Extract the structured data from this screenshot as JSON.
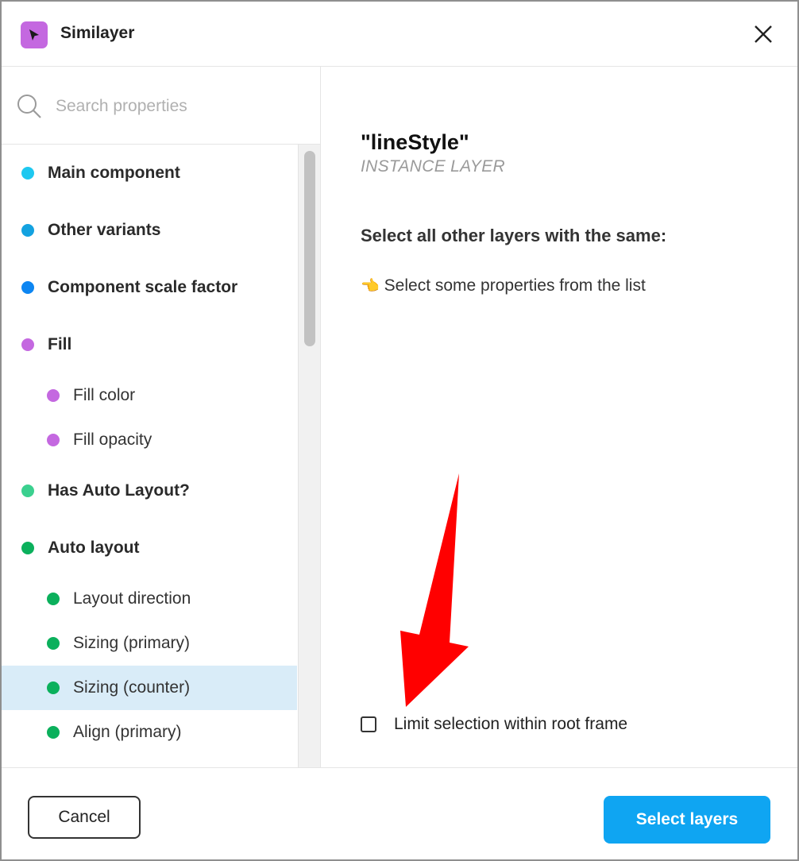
{
  "window": {
    "title": "Similayer",
    "app_icon": "cursor-arrow-icon",
    "app_icon_color": "#c468e0",
    "close_icon": "close-icon"
  },
  "search": {
    "placeholder": "Search properties",
    "value": ""
  },
  "properties": [
    {
      "label": "Main component",
      "color": "#1ec8f0",
      "level": "top",
      "selected": false
    },
    {
      "label": "Other variants",
      "color": "#13a2e0",
      "level": "top",
      "selected": false
    },
    {
      "label": "Component scale factor",
      "color": "#0d86f2",
      "level": "top",
      "selected": false
    },
    {
      "label": "Fill",
      "color": "#c468e0",
      "level": "top",
      "selected": false
    },
    {
      "label": "Fill color",
      "color": "#c468e0",
      "level": "sub",
      "selected": false
    },
    {
      "label": "Fill opacity",
      "color": "#c468e0",
      "level": "sub",
      "selected": false
    },
    {
      "label": "Has Auto Layout?",
      "color": "#3bd08f",
      "level": "top",
      "selected": false
    },
    {
      "label": "Auto layout",
      "color": "#0bb05c",
      "level": "top",
      "selected": false
    },
    {
      "label": "Layout direction",
      "color": "#0bb05c",
      "level": "sub",
      "selected": false
    },
    {
      "label": "Sizing (primary)",
      "color": "#0bb05c",
      "level": "sub",
      "selected": false
    },
    {
      "label": "Sizing (counter)",
      "color": "#0bb05c",
      "level": "sub",
      "selected": true
    },
    {
      "label": "Align (primary)",
      "color": "#0bb05c",
      "level": "sub",
      "selected": false
    }
  ],
  "detail": {
    "layer_name": "\"lineStyle\"",
    "layer_type": "INSTANCE LAYER",
    "heading": "Select all other layers with the same:",
    "hint_icon": "👈",
    "hint": "Select some properties from the list",
    "limit_label": "Limit selection within root frame",
    "limit_checked": false
  },
  "footer": {
    "cancel_label": "Cancel",
    "select_label": "Select layers",
    "accent": "#0fa5f2"
  },
  "colors": {
    "selected_row": "#d9ecf8",
    "annotation_arrow": "#ff0000"
  }
}
